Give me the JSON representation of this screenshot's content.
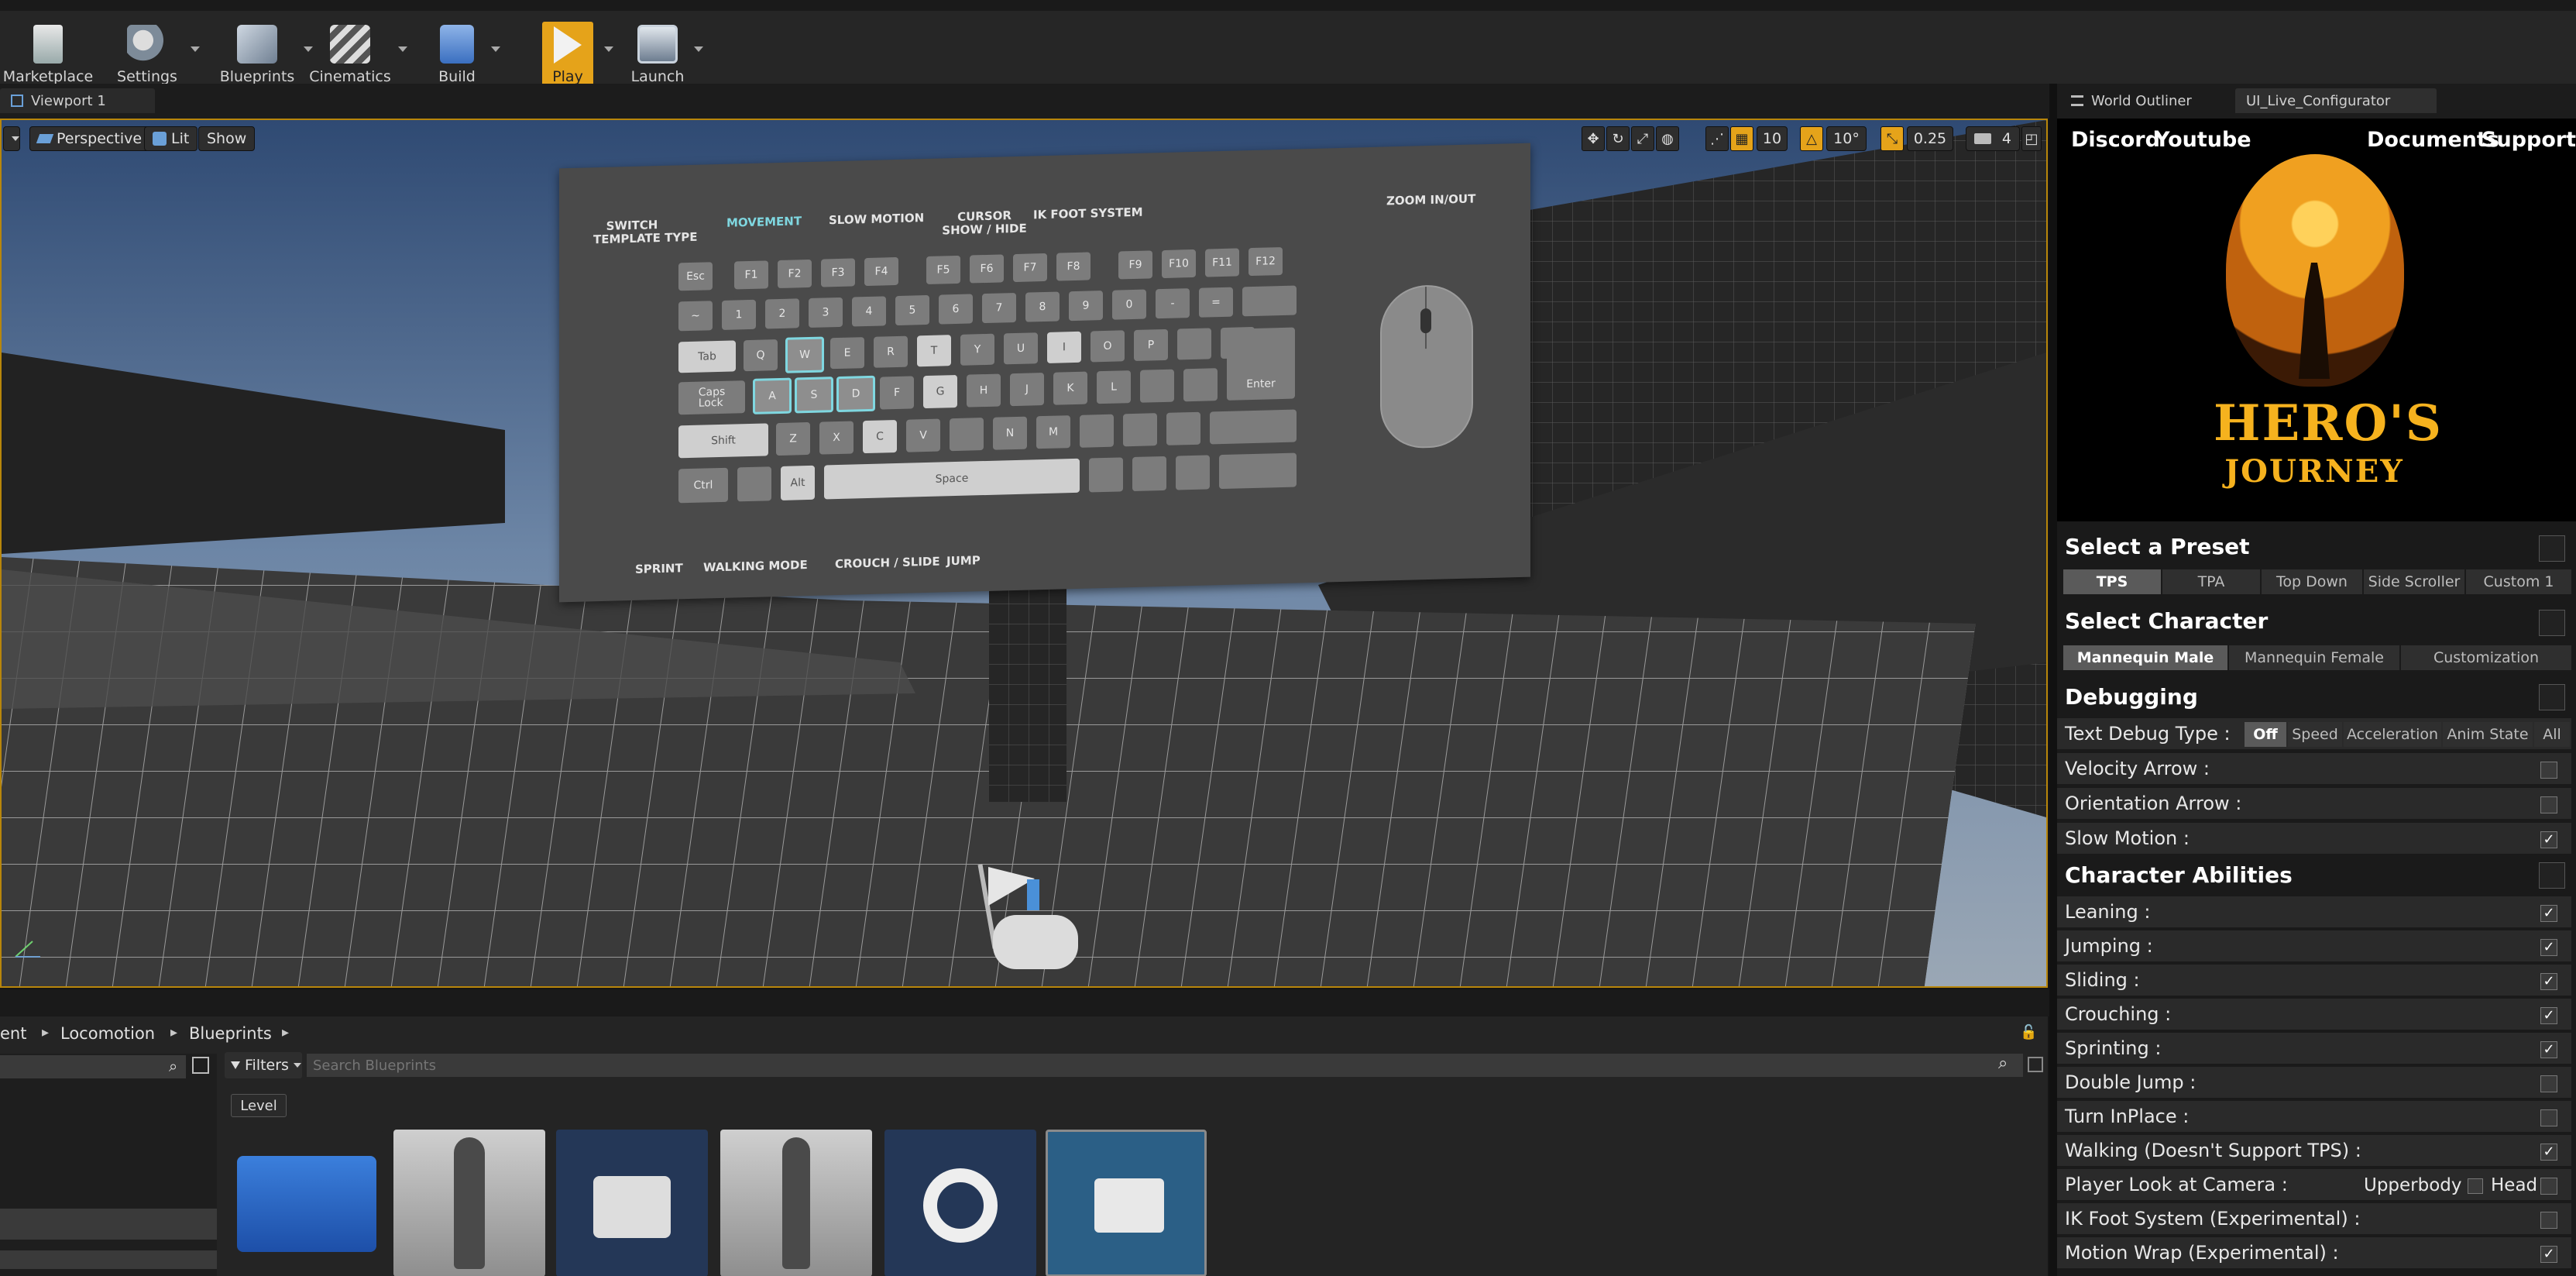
{
  "toolbar": {
    "items": [
      {
        "label": "Marketplace",
        "icon": "marketplace-icon"
      },
      {
        "label": "Settings",
        "icon": "settings-gears-icon"
      },
      {
        "label": "Blueprints",
        "icon": "blueprints-icon"
      },
      {
        "label": "Cinematics",
        "icon": "clapper-icon"
      },
      {
        "label": "Build",
        "icon": "build-blocks-icon"
      },
      {
        "label": "Play",
        "icon": "play-icon"
      },
      {
        "label": "Launch",
        "icon": "launch-monitor-icon"
      }
    ]
  },
  "viewport": {
    "tab": "Viewport 1",
    "perspective": "Perspective",
    "lit": "Lit",
    "show": "Show",
    "grid_snap": "10",
    "rotation_snap": "10°",
    "scale_snap": "0.25",
    "camera_speed": "4"
  },
  "billboard": {
    "labels": {
      "switch": "SWITCH\nTEMPLATE TYPE",
      "movement": "MOVEMENT",
      "slow_motion": "SLOW MOTION",
      "cursor": "CURSOR\nSHOW / HIDE",
      "ik_foot": "IK FOOT SYSTEM",
      "zoom": "ZOOM IN/OUT",
      "sprint": "SPRINT",
      "walking_mode": "WALKING MODE",
      "crouch": "CROUCH / SLIDE",
      "jump": "JUMP"
    },
    "keys": {
      "esc": "Esc",
      "f1": "F1",
      "f2": "F2",
      "f3": "F3",
      "f4": "F4",
      "f5": "F5",
      "f6": "F6",
      "f7": "F7",
      "f8": "F8",
      "f9": "F9",
      "f10": "F10",
      "f11": "F11",
      "f12": "F12",
      "tilde": "~",
      "n1": "1",
      "n2": "2",
      "n3": "3",
      "n4": "4",
      "n5": "5",
      "n6": "6",
      "n7": "7",
      "n8": "8",
      "n9": "9",
      "n0": "0",
      "minus": "-",
      "eq": "=",
      "tab": "Tab",
      "q": "Q",
      "w": "W",
      "e": "E",
      "r": "R",
      "t": "T",
      "y": "Y",
      "u": "U",
      "i": "I",
      "o": "O",
      "p": "P",
      "caps": "Caps\nLock",
      "a": "A",
      "s": "S",
      "d": "D",
      "f": "F",
      "g": "G",
      "h": "H",
      "j": "J",
      "k": "K",
      "l": "L",
      "enter": "Enter",
      "shift": "Shift",
      "z": "Z",
      "x": "X",
      "c": "C",
      "v": "V",
      "n": "N",
      "m": "M",
      "ctrl": "Ctrl",
      "alt": "Alt",
      "space": "Space"
    }
  },
  "outliner": {
    "tab1": "World Outliner",
    "tab2": "UI_Live_Configurator"
  },
  "configurator": {
    "links": {
      "discord": "Discord",
      "youtube": "Youtube",
      "documents": "Documents",
      "support": "Support"
    },
    "logo": {
      "line1": "HERO'S",
      "line2": "JOURNEY"
    },
    "preset": {
      "title": "Select a Preset",
      "options": [
        "TPS",
        "TPA",
        "Top Down",
        "Side Scroller",
        "Custom 1"
      ],
      "selected": "TPS"
    },
    "character": {
      "title": "Select Character",
      "options": [
        "Mannequin Male",
        "Mannequin Female",
        "Customization"
      ],
      "selected": "Mannequin Male"
    },
    "debugging": {
      "title": "Debugging",
      "text_debug_label": "Text Debug Type :",
      "text_debug_options": [
        "Off",
        "Speed",
        "Acceleration",
        "Anim State",
        "All"
      ],
      "text_debug_selected": "Off",
      "rows": [
        {
          "label": "Velocity Arrow :",
          "checked": false
        },
        {
          "label": "Orientation Arrow :",
          "checked": false
        },
        {
          "label": "Slow Motion :",
          "checked": true
        }
      ]
    },
    "abilities": {
      "title": "Character Abilities",
      "rows": [
        {
          "label": "Leaning :",
          "checked": true
        },
        {
          "label": "Jumping :",
          "checked": true
        },
        {
          "label": "Sliding :",
          "checked": true
        },
        {
          "label": "Crouching :",
          "checked": true
        },
        {
          "label": "Sprinting :",
          "checked": true
        },
        {
          "label": "Double Jump :",
          "checked": false
        },
        {
          "label": "Turn InPlace :",
          "checked": false
        },
        {
          "label": "Walking (Doesn't Support TPS) :",
          "checked": true
        },
        {
          "label": "Player Look at Camera :",
          "checked": false,
          "extra": {
            "upperbody": "Upperbody",
            "head": "Head"
          }
        },
        {
          "label": "IK Foot System (Experimental) :",
          "checked": false
        },
        {
          "label": "Motion Wrap (Experimental) :",
          "checked": true
        }
      ]
    }
  },
  "content_browser": {
    "breadcrumb": [
      "ent",
      "Locomotion",
      "Blueprints"
    ],
    "filters": "Filters",
    "search_placeholder": "Search Blueprints",
    "level_chip": "Level"
  },
  "colors": {
    "play_accent": "#e5a31a",
    "highlight_cyan": "#7fd7e0",
    "viewport_border": "#b8860b"
  }
}
